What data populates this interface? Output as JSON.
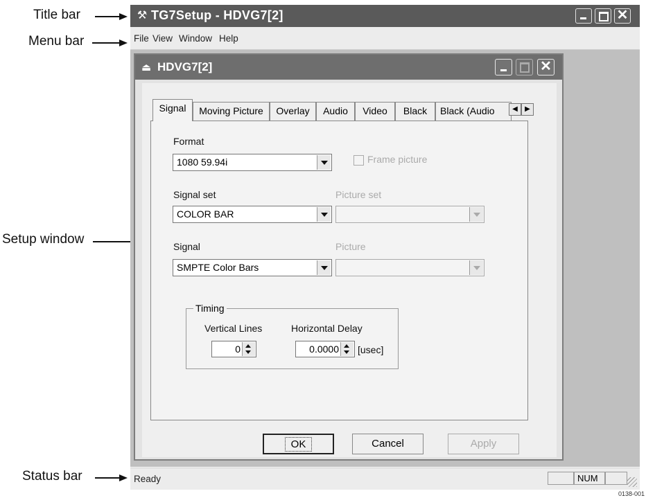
{
  "callouts": {
    "title_bar": "Title bar",
    "menu_bar": "Menu bar",
    "setup_window": "Setup window",
    "status_bar": "Status bar"
  },
  "main_window": {
    "title": "TG7Setup - HDVG7[2]",
    "icon": "app-icon",
    "menu": [
      "File",
      "View",
      "Window",
      "Help"
    ]
  },
  "child_window": {
    "title": "HDVG7[2]",
    "icon": "document-icon"
  },
  "tabs": [
    "Signal",
    "Moving Picture",
    "Overlay",
    "Audio",
    "Video",
    "Black",
    "Black (Audio"
  ],
  "signal_tab": {
    "format_label": "Format",
    "format_value": "1080 59.94i",
    "frame_picture_label": "Frame picture",
    "signal_set_label": "Signal set",
    "signal_set_value": "COLOR BAR",
    "picture_set_label": "Picture set",
    "signal_label": "Signal",
    "signal_value": "SMPTE Color Bars",
    "picture_label": "Picture",
    "timing": {
      "title": "Timing",
      "vertical_label": "Vertical Lines",
      "vertical_value": "0",
      "horizontal_label": "Horizontal Delay",
      "horizontal_value": "0.0000",
      "unit": "[usec]"
    }
  },
  "buttons": {
    "ok": "OK",
    "cancel": "Cancel",
    "apply": "Apply"
  },
  "status": {
    "text": "Ready",
    "num": "NUM"
  },
  "figure_code": "0138-001"
}
